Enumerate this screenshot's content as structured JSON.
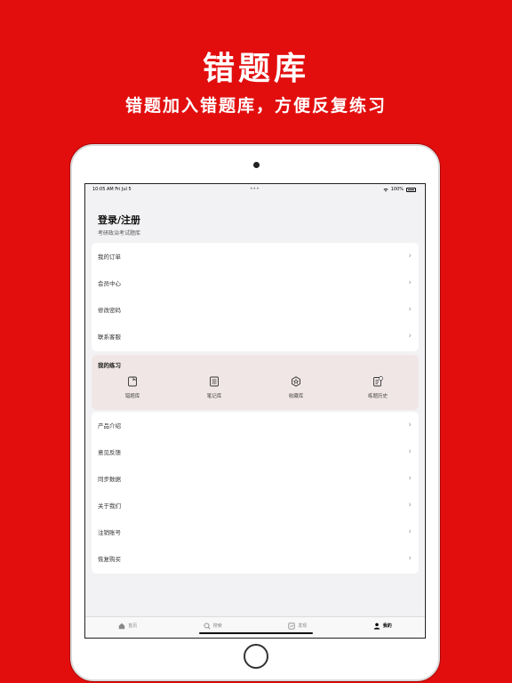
{
  "promo": {
    "headline": "错题库",
    "subline": "错题加入错题库，方便反复练习"
  },
  "status_bar": {
    "time": "10:05 AM   Fri Jul 5",
    "dots": "•••",
    "battery": "100%"
  },
  "profile": {
    "title": "登录/注册",
    "subtitle": "考研政治考试题库"
  },
  "account_menu": [
    {
      "label": "我的订单"
    },
    {
      "label": "会员中心"
    },
    {
      "label": "修改密码"
    },
    {
      "label": "联系客服"
    }
  ],
  "practice": {
    "title": "我的练习",
    "items": [
      {
        "label": "错题库",
        "icon": "wrong-questions-icon"
      },
      {
        "label": "笔记库",
        "icon": "notes-icon"
      },
      {
        "label": "收藏库",
        "icon": "favorites-icon"
      },
      {
        "label": "练题历史",
        "icon": "history-icon"
      }
    ]
  },
  "other_menu": [
    {
      "label": "产品介绍"
    },
    {
      "label": "意见反馈"
    },
    {
      "label": "同步数据"
    },
    {
      "label": "关于我们"
    },
    {
      "label": "注销账号"
    },
    {
      "label": "恢复购买"
    }
  ],
  "tabbar": [
    {
      "label": "首页",
      "icon": "home-icon",
      "active": false
    },
    {
      "label": "搜索",
      "icon": "search-icon",
      "active": false
    },
    {
      "label": "发现",
      "icon": "discover-icon",
      "active": false
    },
    {
      "label": "我的",
      "icon": "profile-icon",
      "active": true
    }
  ],
  "colors": {
    "background": "#e20e0e",
    "practice_card": "#f1e6e6"
  }
}
